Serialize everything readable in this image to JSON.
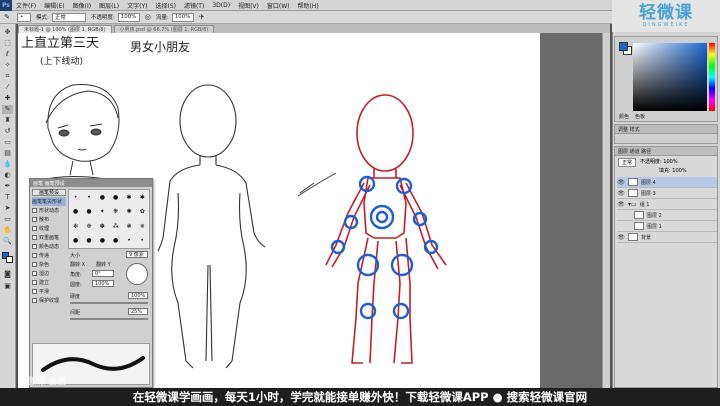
{
  "app": {
    "logo": "Ps"
  },
  "menu": [
    "文件(F)",
    "编辑(E)",
    "图像(I)",
    "图层(L)",
    "文字(Y)",
    "选择(S)",
    "滤镜(T)",
    "3D(D)",
    "视图(V)",
    "窗口(W)",
    "帮助(H)"
  ],
  "options": {
    "mode_label": "模式:",
    "mode_value": "正常",
    "opacity_label": "不透明度:",
    "opacity_value": "100%",
    "flow_label": "流量:",
    "flow_value": "100%"
  },
  "tabs": [
    {
      "label": "未标题-1 @ 100% (图层 1, RGB/8)"
    },
    {
      "label": "小男孩.psd @ 66.7% (图层 1, RGB/8)"
    }
  ],
  "brand": {
    "name": "轻微课",
    "sub": "QINGWEIKE"
  },
  "canvas_text": {
    "line1": "上直立第三天",
    "line2": "(上下线动)",
    "line3": "男女小朋友"
  },
  "color_panel": {
    "tabs": [
      "颜色",
      "色板"
    ]
  },
  "adjust_panel": {
    "title": "调整 样式"
  },
  "layers": {
    "title": "图层 通道 路径",
    "blend": "正常",
    "opacity": "不透明度: 100%",
    "fill": "填充: 100%",
    "rows": [
      {
        "name": "图层 4",
        "selected": true
      },
      {
        "name": "图层 3",
        "selected": false
      },
      {
        "name": "组 1",
        "selected": false
      },
      {
        "name": "图层 2",
        "selected": false
      },
      {
        "name": "图层 1",
        "selected": false
      },
      {
        "name": "背景",
        "selected": false
      }
    ]
  },
  "brush_panel": {
    "title": "画笔 画笔预设",
    "button": "画笔预设",
    "items": [
      "画笔笔尖形状",
      "形状动态",
      "散布",
      "纹理",
      "双重画笔",
      "颜色动态",
      "传递",
      "杂色",
      "湿边",
      "建立",
      "平滑",
      "保护纹理"
    ],
    "size_label": "大小",
    "size_value": "9 像素",
    "flipx": "翻转 X",
    "flipy": "翻转 Y",
    "angle_label": "角度:",
    "angle_value": "0°",
    "round_label": "圆度:",
    "round_value": "100%",
    "hard_label": "硬度",
    "hard_value": "100%",
    "spacing_label": "间距",
    "spacing_value": "25%"
  },
  "banner": "在轻微课学画画，每天1小时，学完就能接单赚外快！下载轻微课APP ● 搜索轻微课官网",
  "watermark": "轻微课 画画",
  "status": "轻微课"
}
